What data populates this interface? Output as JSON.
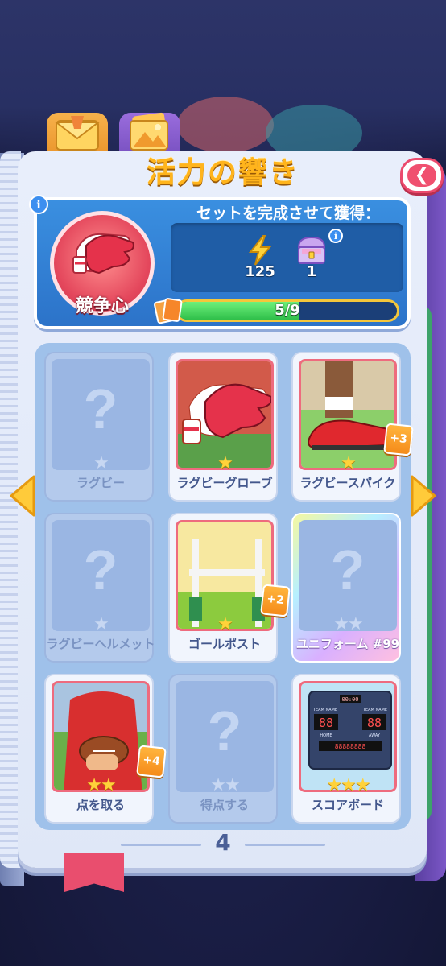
{
  "title": "活力の響き",
  "close_icon_glyph": "❮",
  "reward": {
    "set_label": "セットを完成させて獲得：",
    "items": [
      {
        "icon": "lightning-icon",
        "count": "125"
      },
      {
        "icon": "treasure-chest-icon",
        "count": "1"
      }
    ],
    "info_glyph": "i"
  },
  "medal": {
    "label": "競争心",
    "icon": "glove-icon"
  },
  "progress": {
    "text": "5/9",
    "fraction": 0.5556
  },
  "cards": [
    {
      "label": "ラグビー",
      "state": "locked",
      "stars": 1,
      "dup": ""
    },
    {
      "label": "ラグビーグローブ",
      "state": "owned",
      "stars": 1,
      "dup": ""
    },
    {
      "label": "ラグビースパイク",
      "state": "owned",
      "stars": 1,
      "dup": "+3"
    },
    {
      "label": "ラグビーヘルメット",
      "state": "locked",
      "stars": 1,
      "dup": ""
    },
    {
      "label": "ゴールポスト",
      "state": "owned",
      "stars": 1,
      "dup": "+2"
    },
    {
      "label": "ユニフォーム #99",
      "state": "gold",
      "stars": 2,
      "dup": ""
    },
    {
      "label": "点を取る",
      "state": "owned",
      "stars": 2,
      "dup": "+4"
    },
    {
      "label": "得点する",
      "state": "locked",
      "stars": 2,
      "dup": ""
    },
    {
      "label": "スコアボード",
      "state": "owned",
      "stars": 3,
      "dup": ""
    }
  ],
  "qmark": "?",
  "page_number": "4",
  "scoreboard": {
    "time": "00:00",
    "home_label": "TEAM NAME",
    "away_label": "TEAM NAME",
    "home_score": "88",
    "away_score": "88",
    "home_sub": "HOME",
    "away_sub": "AWAY",
    "bottom": "88888888"
  }
}
